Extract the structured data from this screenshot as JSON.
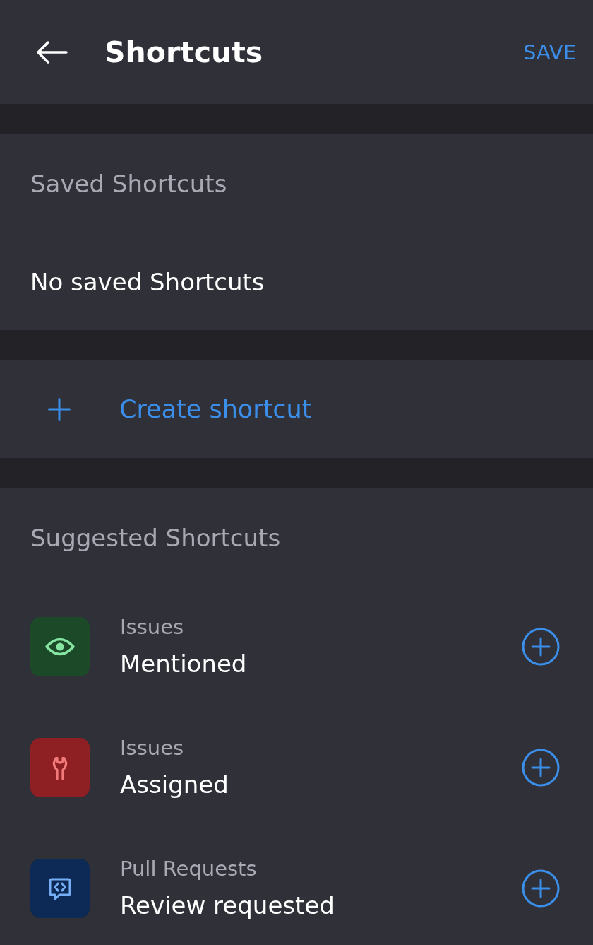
{
  "header": {
    "title": "Shortcuts",
    "action": "SAVE"
  },
  "saved": {
    "heading": "Saved Shortcuts",
    "empty_text": "No saved Shortcuts"
  },
  "create": {
    "label": "Create shortcut"
  },
  "suggested": {
    "heading": "Suggested Shortcuts",
    "items": [
      {
        "kind": "eye",
        "category": "Issues",
        "title": "Mentioned",
        "color": "#1c4a28"
      },
      {
        "kind": "wrench",
        "category": "Issues",
        "title": "Assigned",
        "color": "#8e1f23"
      },
      {
        "kind": "code",
        "category": "Pull Requests",
        "title": "Review requested",
        "color": "#0c2a55"
      }
    ]
  }
}
